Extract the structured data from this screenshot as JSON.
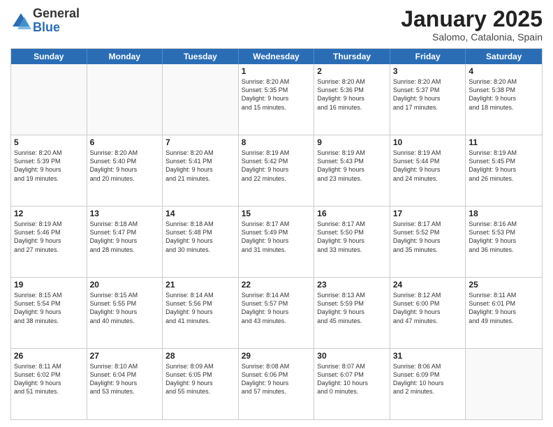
{
  "logo": {
    "general": "General",
    "blue": "Blue"
  },
  "title": "January 2025",
  "subtitle": "Salomo, Catalonia, Spain",
  "days": [
    "Sunday",
    "Monday",
    "Tuesday",
    "Wednesday",
    "Thursday",
    "Friday",
    "Saturday"
  ],
  "weeks": [
    [
      {
        "day": "",
        "info": ""
      },
      {
        "day": "",
        "info": ""
      },
      {
        "day": "",
        "info": ""
      },
      {
        "day": "1",
        "info": "Sunrise: 8:20 AM\nSunset: 5:35 PM\nDaylight: 9 hours\nand 15 minutes."
      },
      {
        "day": "2",
        "info": "Sunrise: 8:20 AM\nSunset: 5:36 PM\nDaylight: 9 hours\nand 16 minutes."
      },
      {
        "day": "3",
        "info": "Sunrise: 8:20 AM\nSunset: 5:37 PM\nDaylight: 9 hours\nand 17 minutes."
      },
      {
        "day": "4",
        "info": "Sunrise: 8:20 AM\nSunset: 5:38 PM\nDaylight: 9 hours\nand 18 minutes."
      }
    ],
    [
      {
        "day": "5",
        "info": "Sunrise: 8:20 AM\nSunset: 5:39 PM\nDaylight: 9 hours\nand 19 minutes."
      },
      {
        "day": "6",
        "info": "Sunrise: 8:20 AM\nSunset: 5:40 PM\nDaylight: 9 hours\nand 20 minutes."
      },
      {
        "day": "7",
        "info": "Sunrise: 8:20 AM\nSunset: 5:41 PM\nDaylight: 9 hours\nand 21 minutes."
      },
      {
        "day": "8",
        "info": "Sunrise: 8:19 AM\nSunset: 5:42 PM\nDaylight: 9 hours\nand 22 minutes."
      },
      {
        "day": "9",
        "info": "Sunrise: 8:19 AM\nSunset: 5:43 PM\nDaylight: 9 hours\nand 23 minutes."
      },
      {
        "day": "10",
        "info": "Sunrise: 8:19 AM\nSunset: 5:44 PM\nDaylight: 9 hours\nand 24 minutes."
      },
      {
        "day": "11",
        "info": "Sunrise: 8:19 AM\nSunset: 5:45 PM\nDaylight: 9 hours\nand 26 minutes."
      }
    ],
    [
      {
        "day": "12",
        "info": "Sunrise: 8:19 AM\nSunset: 5:46 PM\nDaylight: 9 hours\nand 27 minutes."
      },
      {
        "day": "13",
        "info": "Sunrise: 8:18 AM\nSunset: 5:47 PM\nDaylight: 9 hours\nand 28 minutes."
      },
      {
        "day": "14",
        "info": "Sunrise: 8:18 AM\nSunset: 5:48 PM\nDaylight: 9 hours\nand 30 minutes."
      },
      {
        "day": "15",
        "info": "Sunrise: 8:17 AM\nSunset: 5:49 PM\nDaylight: 9 hours\nand 31 minutes."
      },
      {
        "day": "16",
        "info": "Sunrise: 8:17 AM\nSunset: 5:50 PM\nDaylight: 9 hours\nand 33 minutes."
      },
      {
        "day": "17",
        "info": "Sunrise: 8:17 AM\nSunset: 5:52 PM\nDaylight: 9 hours\nand 35 minutes."
      },
      {
        "day": "18",
        "info": "Sunrise: 8:16 AM\nSunset: 5:53 PM\nDaylight: 9 hours\nand 36 minutes."
      }
    ],
    [
      {
        "day": "19",
        "info": "Sunrise: 8:15 AM\nSunset: 5:54 PM\nDaylight: 9 hours\nand 38 minutes."
      },
      {
        "day": "20",
        "info": "Sunrise: 8:15 AM\nSunset: 5:55 PM\nDaylight: 9 hours\nand 40 minutes."
      },
      {
        "day": "21",
        "info": "Sunrise: 8:14 AM\nSunset: 5:56 PM\nDaylight: 9 hours\nand 41 minutes."
      },
      {
        "day": "22",
        "info": "Sunrise: 8:14 AM\nSunset: 5:57 PM\nDaylight: 9 hours\nand 43 minutes."
      },
      {
        "day": "23",
        "info": "Sunrise: 8:13 AM\nSunset: 5:59 PM\nDaylight: 9 hours\nand 45 minutes."
      },
      {
        "day": "24",
        "info": "Sunrise: 8:12 AM\nSunset: 6:00 PM\nDaylight: 9 hours\nand 47 minutes."
      },
      {
        "day": "25",
        "info": "Sunrise: 8:11 AM\nSunset: 6:01 PM\nDaylight: 9 hours\nand 49 minutes."
      }
    ],
    [
      {
        "day": "26",
        "info": "Sunrise: 8:11 AM\nSunset: 6:02 PM\nDaylight: 9 hours\nand 51 minutes."
      },
      {
        "day": "27",
        "info": "Sunrise: 8:10 AM\nSunset: 6:04 PM\nDaylight: 9 hours\nand 53 minutes."
      },
      {
        "day": "28",
        "info": "Sunrise: 8:09 AM\nSunset: 6:05 PM\nDaylight: 9 hours\nand 55 minutes."
      },
      {
        "day": "29",
        "info": "Sunrise: 8:08 AM\nSunset: 6:06 PM\nDaylight: 9 hours\nand 57 minutes."
      },
      {
        "day": "30",
        "info": "Sunrise: 8:07 AM\nSunset: 6:07 PM\nDaylight: 10 hours\nand 0 minutes."
      },
      {
        "day": "31",
        "info": "Sunrise: 8:06 AM\nSunset: 6:09 PM\nDaylight: 10 hours\nand 2 minutes."
      },
      {
        "day": "",
        "info": ""
      }
    ]
  ]
}
